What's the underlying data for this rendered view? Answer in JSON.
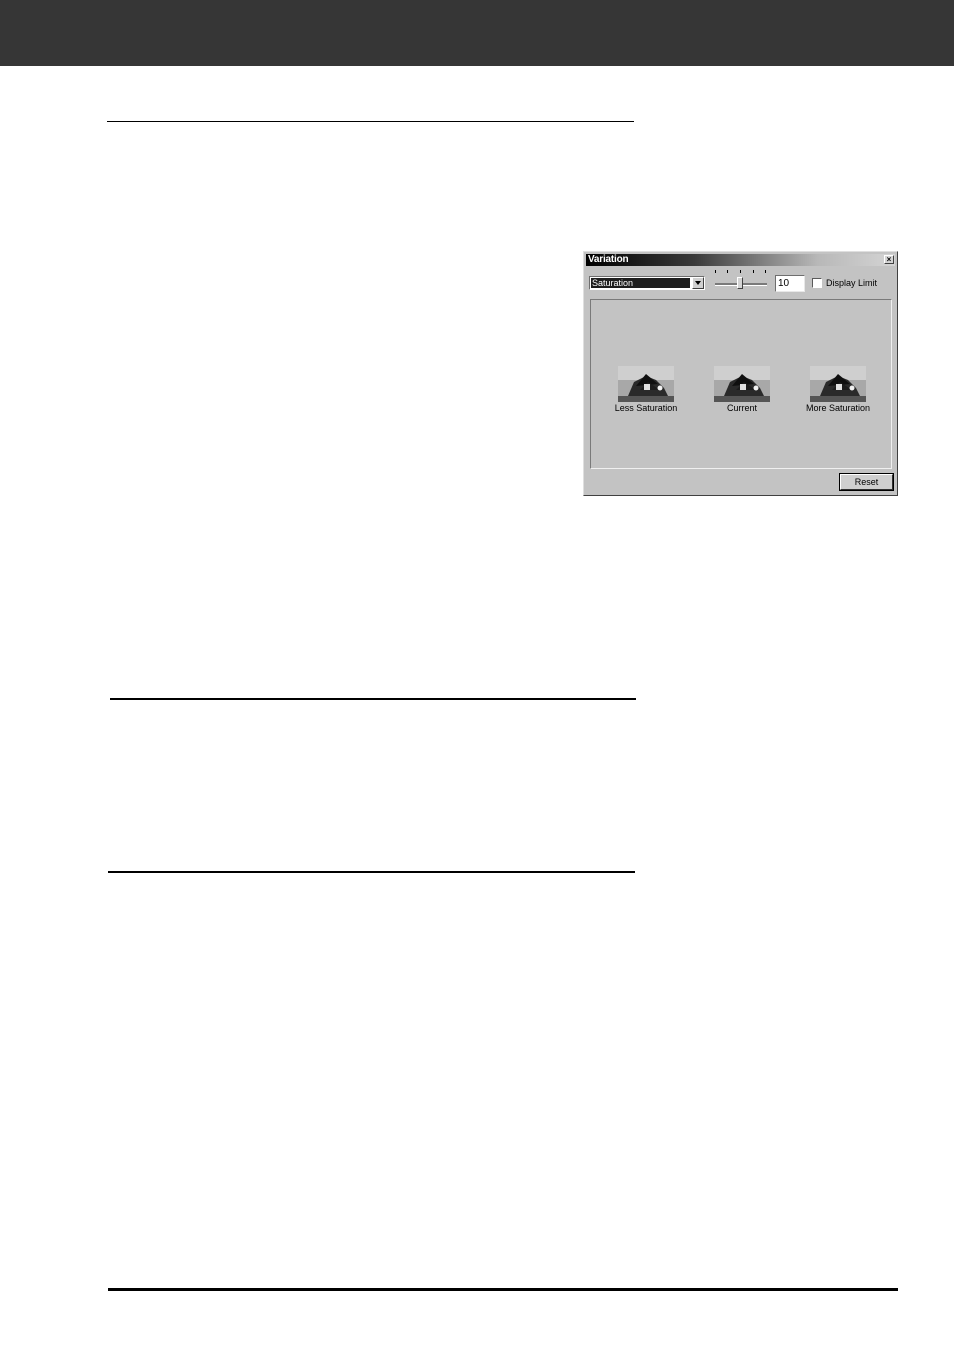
{
  "dialog": {
    "title": "Variation",
    "close_label": "×",
    "mode_select": {
      "selected": "Saturation"
    },
    "slider": {
      "value": 10,
      "tick_count": 5,
      "level_fraction": 0.5
    },
    "value_field": "10",
    "display_limit": {
      "label": "Display Limit",
      "checked": false
    },
    "variants": [
      {
        "label": "Less Saturation"
      },
      {
        "label": "Current"
      },
      {
        "label": "More Saturation"
      }
    ],
    "reset_label": "Reset"
  },
  "colors": {
    "header_band": "#363636",
    "dialog_face": "#c3c3c3",
    "rule": "#000000"
  }
}
